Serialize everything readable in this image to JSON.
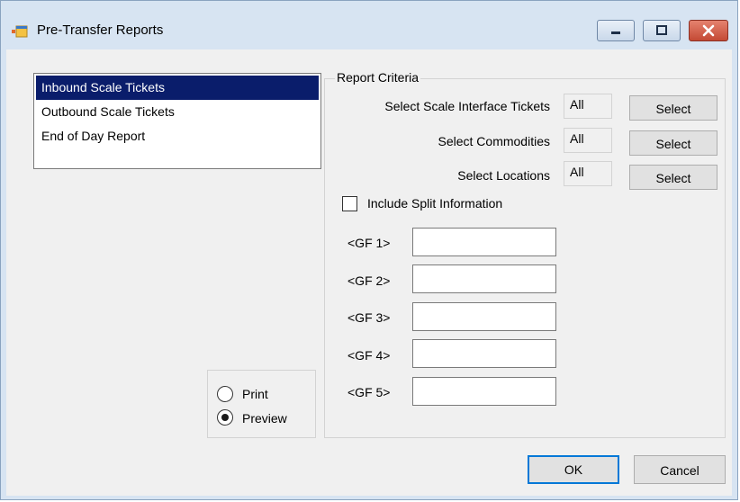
{
  "window": {
    "title": "Pre-Transfer Reports",
    "app_icon": "app-window-icon",
    "controls": [
      "minimize-icon",
      "maximize-icon",
      "close-icon"
    ]
  },
  "report_list": {
    "items": [
      "Inbound Scale Tickets",
      "Outbound Scale Tickets",
      "End of Day Report"
    ],
    "selected_index": 0
  },
  "criteria": {
    "group_label": "Report Criteria",
    "rows": [
      {
        "label": "Select Scale Interface Tickets",
        "value": "All",
        "button": "Select"
      },
      {
        "label": "Select Commodities",
        "value": "All",
        "button": "Select"
      },
      {
        "label": "Select Locations",
        "value": "All",
        "button": "Select"
      }
    ],
    "split_info": {
      "label": "Include Split Information",
      "checked": false
    },
    "gf_fields": [
      {
        "label": "<GF 1>",
        "value": ""
      },
      {
        "label": "<GF 2>",
        "value": ""
      },
      {
        "label": "<GF 3>",
        "value": ""
      },
      {
        "label": "<GF 4>",
        "value": ""
      },
      {
        "label": "<GF 5>",
        "value": ""
      }
    ]
  },
  "output": {
    "print_label": "Print",
    "preview_label": "Preview",
    "selected": "Preview"
  },
  "footer": {
    "ok_label": "OK",
    "cancel_label": "Cancel"
  },
  "colors": {
    "selection": "#0a1d6b",
    "titlebar": "#d7e4f2",
    "close_button": "#c44a34",
    "ok_border": "#0078d7"
  }
}
